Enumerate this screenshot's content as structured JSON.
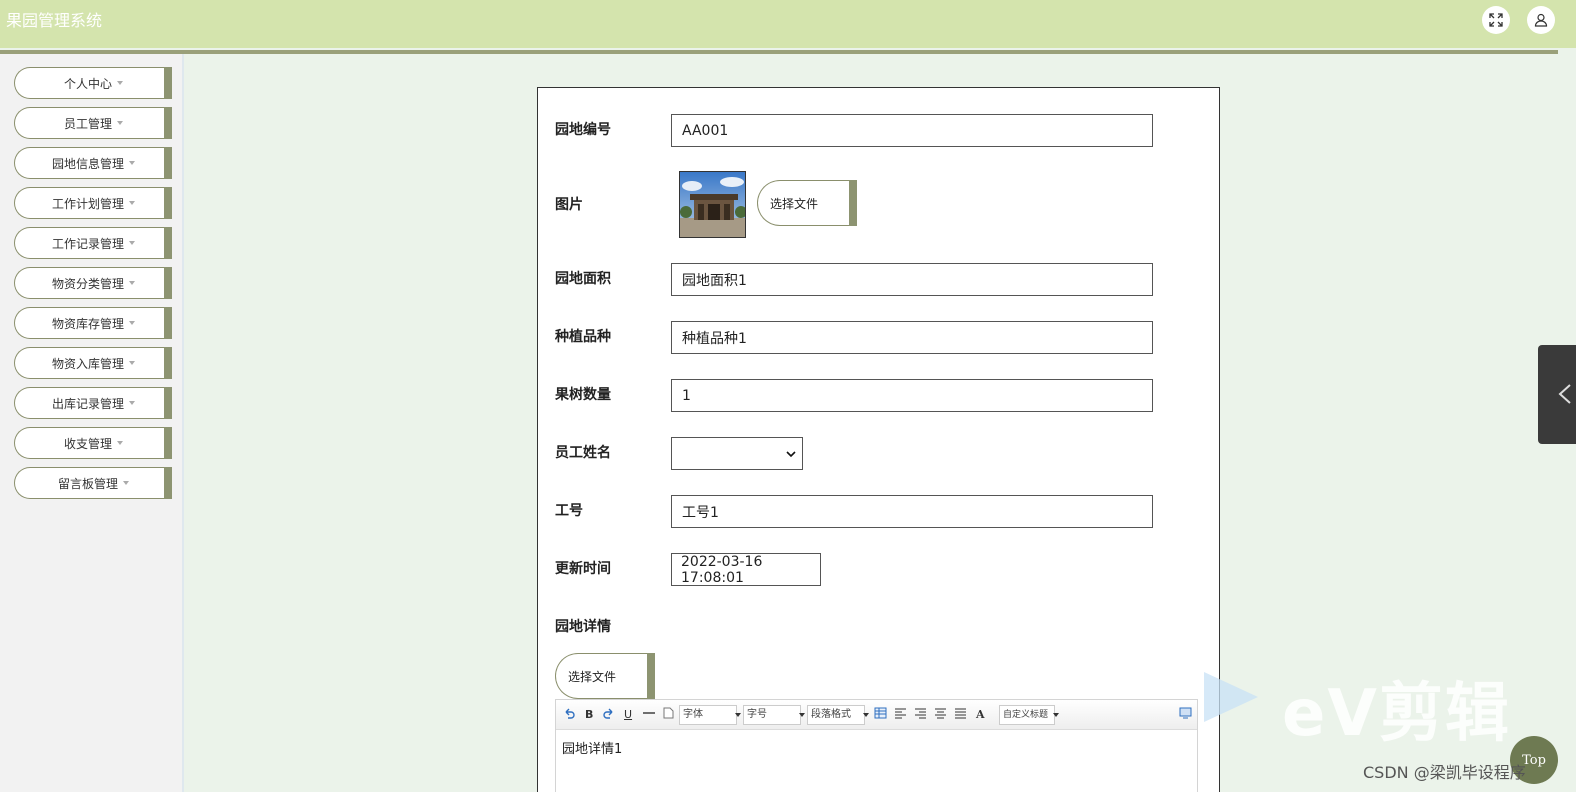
{
  "app": {
    "title": "果园管理系统"
  },
  "sidebar": {
    "items": [
      {
        "label": "个人中心"
      },
      {
        "label": "员工管理"
      },
      {
        "label": "园地信息管理"
      },
      {
        "label": "工作计划管理"
      },
      {
        "label": "工作记录管理"
      },
      {
        "label": "物资分类管理"
      },
      {
        "label": "物资库存管理"
      },
      {
        "label": "物资入库管理"
      },
      {
        "label": "出库记录管理"
      },
      {
        "label": "收支管理"
      },
      {
        "label": "留言板管理"
      }
    ]
  },
  "form": {
    "field_code": {
      "label": "园地编号",
      "value": "AA001"
    },
    "field_image": {
      "label": "图片",
      "button": "选择文件"
    },
    "field_area": {
      "label": "园地面积",
      "value": "园地面积1"
    },
    "field_variety": {
      "label": "种植品种",
      "value": "种植品种1"
    },
    "field_tree_count": {
      "label": "果树数量",
      "value": "1"
    },
    "field_employee": {
      "label": "员工姓名",
      "value": ""
    },
    "field_job_no": {
      "label": "工号",
      "value": "工号1"
    },
    "field_updated": {
      "label": "更新时间",
      "value": "2022-03-16 17:08:01"
    },
    "field_details": {
      "label": "园地详情",
      "button": "选择文件"
    }
  },
  "editor": {
    "toolbar": {
      "bold": "B",
      "underline": "U",
      "font_family": "字体",
      "font_size": "字号",
      "paragraph": "段落格式",
      "font_color": "A",
      "custom_heading": "自定义标题"
    },
    "content": "园地详情1"
  },
  "overlay": {
    "top_button": "Top",
    "watermark": "eV剪辑",
    "credit": "CSDN @梁凯毕设程序"
  },
  "colors": {
    "header_bg": "#d4e4ad",
    "accent": "#8d9471",
    "page_bg": "#ebf3ea"
  }
}
